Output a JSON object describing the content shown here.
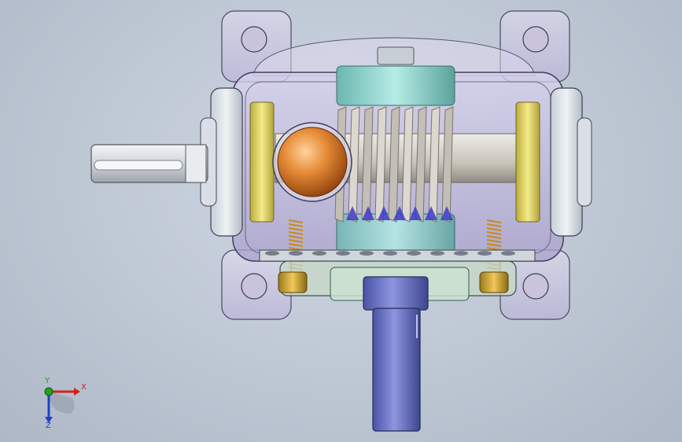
{
  "viewport": {
    "background": "#c3ccd8",
    "model_name": "worm-gear-reducer"
  },
  "triad": {
    "x_label": "X",
    "y_label": "Y",
    "z_label": "Z",
    "x_color": "#d42020",
    "y_color": "#22a022",
    "z_color": "#2040c8"
  },
  "parts": {
    "housing_color": "#b9b2d6",
    "input_shaft_color": "#dde2e6",
    "output_shaft_color": "#6a73c8",
    "worm_color": "#d8d4cc",
    "gear_hub_color": "#8fcfc9",
    "bearing_color": "#e2d860",
    "ball_color": "#e07a2a",
    "spring_color": "#d8a020",
    "feet_color": "#cfc6e4"
  }
}
